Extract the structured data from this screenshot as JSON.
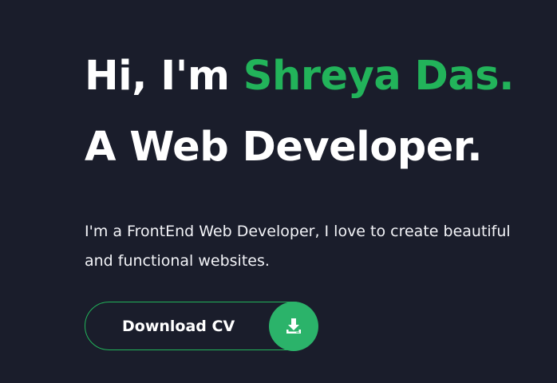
{
  "hero": {
    "greeting_prefix": "Hi, I'm",
    "name": "Shreya Das.",
    "role_line": "A Web Developer.",
    "intro": "I'm a FrontEnd Web Developer, I love to create beautiful and functional websites."
  },
  "cta": {
    "download_label": "Download CV",
    "icon": "download-icon"
  },
  "colors": {
    "background": "#1a1d2b",
    "accent": "#22b35a",
    "text": "#ffffff"
  }
}
